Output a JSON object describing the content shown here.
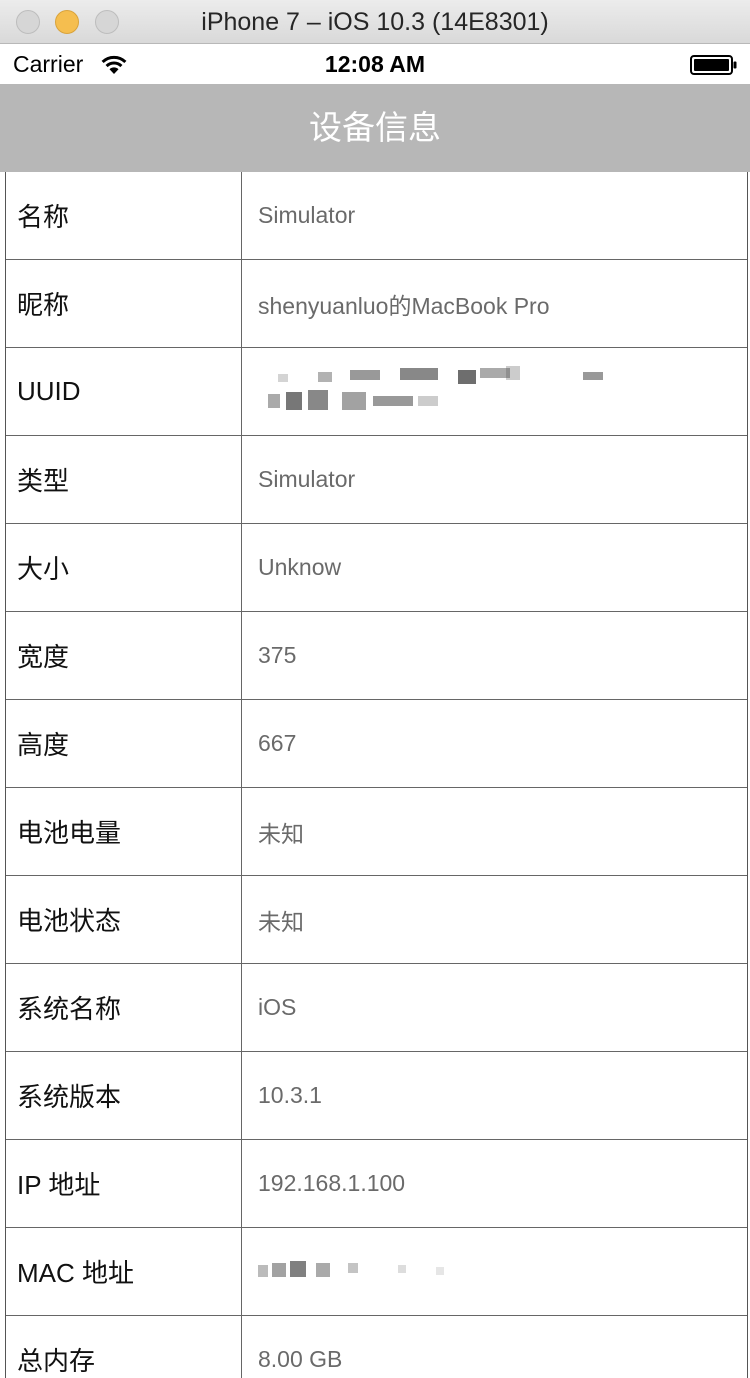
{
  "window": {
    "title": "iPhone 7 – iOS 10.3 (14E8301)"
  },
  "status_bar": {
    "carrier": "Carrier",
    "time": "12:08 AM"
  },
  "nav": {
    "title": "设备信息"
  },
  "rows": [
    {
      "label": "名称",
      "value": "Simulator"
    },
    {
      "label": "昵称",
      "value": "shenyuanluo的MacBook Pro"
    },
    {
      "label": "UUID",
      "value": ""
    },
    {
      "label": "类型",
      "value": "Simulator"
    },
    {
      "label": "大小",
      "value": "Unknow"
    },
    {
      "label": "宽度",
      "value": "375"
    },
    {
      "label": "高度",
      "value": "667"
    },
    {
      "label": "电池电量",
      "value": "未知"
    },
    {
      "label": "电池状态",
      "value": "未知"
    },
    {
      "label": "系统名称",
      "value": "iOS"
    },
    {
      "label": "系统版本",
      "value": "10.3.1"
    },
    {
      "label": "IP 地址",
      "value": "192.168.1.100"
    },
    {
      "label": "MAC 地址",
      "value": ""
    },
    {
      "label": "总内存",
      "value": "8.00 GB"
    }
  ],
  "colors": {
    "nav_background": "#b7b7b7",
    "nav_text": "#ffffff",
    "value_text": "#6a6a6a",
    "close_button": "#d6d6d6",
    "minimize_button": "#f5be4f",
    "zoom_button": "#d6d6d6"
  },
  "icons": [
    "wifi-icon",
    "battery-icon"
  ]
}
